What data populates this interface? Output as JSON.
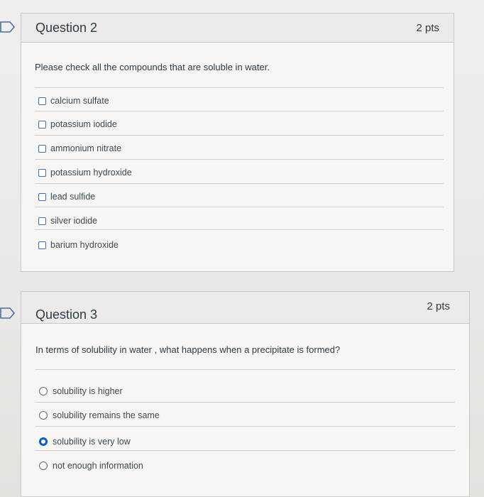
{
  "question2": {
    "title": "Question 2",
    "points": "2 pts",
    "prompt": "Please check all the compounds that are soluble in water.",
    "options": [
      {
        "label": "calcium sulfate",
        "checked": false
      },
      {
        "label": "potassium iodide",
        "checked": false
      },
      {
        "label": "ammonium nitrate",
        "checked": false
      },
      {
        "label": "potassium hydroxide",
        "checked": false
      },
      {
        "label": "lead sulfide",
        "checked": false
      },
      {
        "label": "silver iodide",
        "checked": false
      },
      {
        "label": "barium hydroxide",
        "checked": false
      }
    ]
  },
  "question3": {
    "title": "Question 3",
    "points": "2 pts",
    "prompt": "In terms of solubility in water , what happens when a precipitate is formed?",
    "options": [
      {
        "label": "solubility is higher",
        "selected": false
      },
      {
        "label": "solubility remains the same",
        "selected": false
      },
      {
        "label": "solubility is very low",
        "selected": true
      },
      {
        "label": "not enough information",
        "selected": false
      }
    ]
  },
  "colors": {
    "accent": "#0b5fbf",
    "border": "#c7c8c9",
    "text": "#2d3b45"
  },
  "icons": {
    "flag": "bookmark-flag-icon"
  }
}
